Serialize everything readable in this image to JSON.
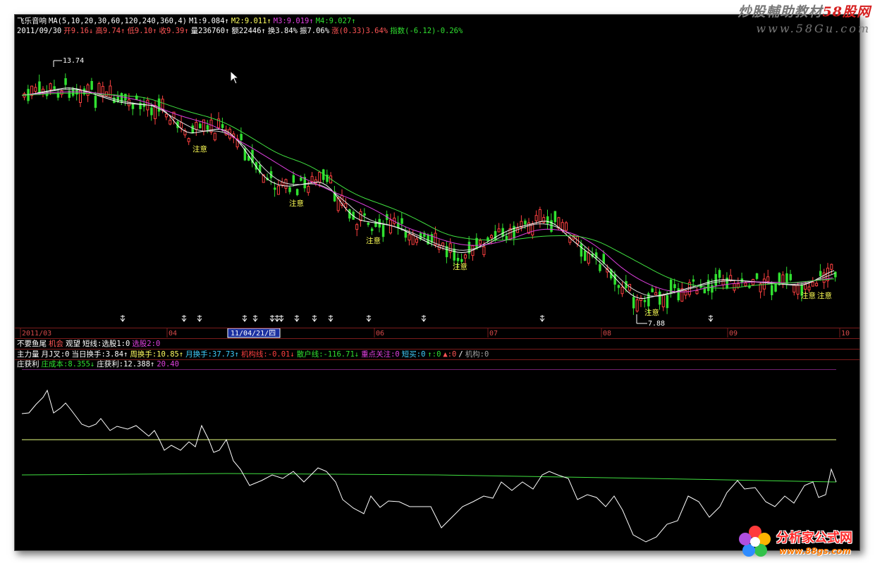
{
  "window": {
    "title": "飞乐音响"
  },
  "header": {
    "line1": [
      {
        "text": "飞乐音响",
        "color": "#ffffff"
      },
      {
        "text": "MA(5,10,20,30,60,120,240,360,4)",
        "color": "#ffffff"
      },
      {
        "text": "M1:9.084↑",
        "color": "#ffffff"
      },
      {
        "text": "M2:9.011↑",
        "color": "#ffff60"
      },
      {
        "text": "M3:9.019↑",
        "color": "#e040e0"
      },
      {
        "text": "M4:9.027↑",
        "color": "#30e030"
      }
    ],
    "line2": [
      {
        "text": "2011/09/30",
        "color": "#ffffff"
      },
      {
        "text": "开9.16↓",
        "color": "#ff5555"
      },
      {
        "text": "高9.74↑",
        "color": "#ff5555"
      },
      {
        "text": "低9.10↑",
        "color": "#ff5555"
      },
      {
        "text": "收9.39↑",
        "color": "#ff5555"
      },
      {
        "text": "量236760↑",
        "color": "#ffffff"
      },
      {
        "text": "额22446↑",
        "color": "#ffffff"
      },
      {
        "text": "换3.84%",
        "color": "#ffffff"
      },
      {
        "text": "振7.06%",
        "color": "#ffffff"
      },
      {
        "text": "涨(0.33)3.64%",
        "color": "#ff5555"
      },
      {
        "text": "指数(-6.12)-0.26%",
        "color": "#30e030"
      }
    ]
  },
  "price_labels": {
    "high": "13.74",
    "low": "7.88"
  },
  "annotations": [
    "注意",
    "注意",
    "注意",
    "注意",
    "注意",
    "注意"
  ],
  "time_axis": {
    "labels": [
      "2011/03",
      "04",
      "05",
      "06",
      "07",
      "08",
      "09",
      "10"
    ],
    "cursor_date": "11/04/21/四"
  },
  "indicator_rows": {
    "row1": [
      {
        "text": "不要鱼尾",
        "color": "#ffffff"
      },
      {
        "text": "机会",
        "color": "#ff5555"
      },
      {
        "text": "观望",
        "color": "#ffffff"
      },
      {
        "text": "短线:选股1:0",
        "color": "#ffffff"
      },
      {
        "text": "选股2:0",
        "color": "#e040e0"
      }
    ],
    "row2": [
      {
        "text": "主力量",
        "color": "#ffffff"
      },
      {
        "text": "月J叉:0",
        "color": "#ffffff"
      },
      {
        "text": "当日换手:3.84↑",
        "color": "#ffffff"
      },
      {
        "text": "周换手:10.85↑",
        "color": "#ffff60"
      },
      {
        "text": "月换手:37.73↑",
        "color": "#40d0ff"
      },
      {
        "text": "机构线:-0.01↓",
        "color": "#ff4040"
      },
      {
        "text": "散户线:-116.71↓",
        "color": "#30e030"
      },
      {
        "text": "重点关注:0",
        "color": "#e040e0"
      },
      {
        "text": "短买:0",
        "color": "#40d0ff"
      },
      {
        "text": "↑:0",
        "color": "#30e030"
      },
      {
        "text": "▲:0",
        "color": "#ff5555"
      },
      {
        "text": "/",
        "color": "#ffffff"
      },
      {
        "text": "机构:0",
        "color": "#a0a0a0"
      }
    ],
    "row3": [
      {
        "text": "庄获利",
        "color": "#ffffff"
      },
      {
        "text": "庄成本:8.355↓",
        "color": "#30e030"
      },
      {
        "text": "庄获利:12.388↑",
        "color": "#ffffff"
      },
      {
        "text": "20.40",
        "color": "#e040e0"
      }
    ]
  },
  "watermarks": {
    "top_title_a": "炒股輔助教材",
    "top_title_b": "58股网",
    "top_url": "www.58Gu.com",
    "bottom_name": "分析家公式网",
    "bottom_url": "www.88gs.com"
  },
  "colors": {
    "up": "#ff4040",
    "down": "#30e030",
    "ma_white": "#ffffff",
    "ma_magenta": "#e040e0",
    "ma_green": "#40e040"
  }
}
